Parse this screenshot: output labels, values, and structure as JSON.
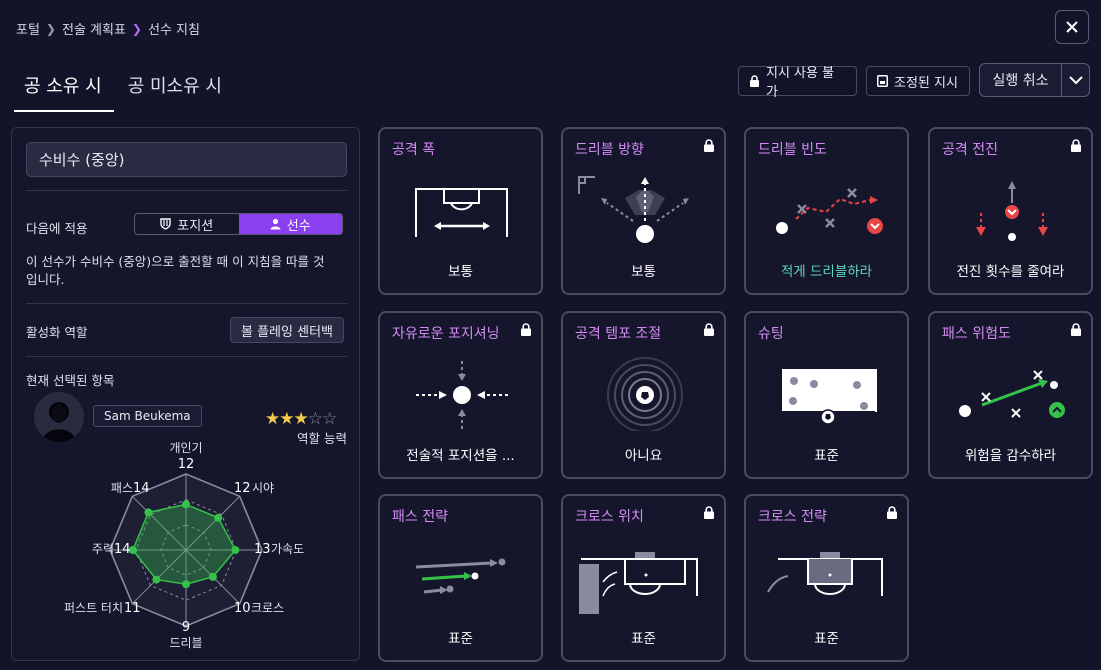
{
  "breadcrumb": [
    "포털",
    "전술 계획표",
    "선수 지침"
  ],
  "tabs": [
    "공 소유 시",
    "공 미소유 시"
  ],
  "top_buttons": {
    "unavailable": "지시 사용 불가",
    "adjusted": "조정된 지시",
    "undo": "실행 취소"
  },
  "left": {
    "role_select": "수비수 (중앙)",
    "apply_label": "다음에 적용",
    "toggle": [
      "포지션",
      "선수"
    ],
    "description": "이 선수가 수비수 (중앙)으로 출전할 때 이 지침을 따를 것입니다.",
    "active_role_label": "활성화 역할",
    "active_role": "볼 플레잉 센터백",
    "selected_label": "현재 선택된 항목",
    "player_name": "Sam Beukema",
    "role_ability": "역할 능력",
    "role_ability_stars": 3,
    "stats": [
      {
        "name": "개인기",
        "value": "12"
      },
      {
        "name": "시야",
        "value": "12"
      },
      {
        "name": "가속도",
        "value": "13"
      },
      {
        "name": "크로스",
        "value": "10"
      },
      {
        "name": "드리블",
        "value": "9"
      },
      {
        "name": "퍼스트 터치",
        "value": "11"
      },
      {
        "name": "주력",
        "value": "14"
      },
      {
        "name": "패스",
        "value": "14"
      }
    ]
  },
  "cards": [
    {
      "title": "공격 폭",
      "value": "보통",
      "locked": false
    },
    {
      "title": "드리블 방향",
      "value": "보통",
      "locked": true
    },
    {
      "title": "드리블 빈도",
      "value": "적게 드리블하라",
      "locked": false
    },
    {
      "title": "공격 전진",
      "value": "전진 횟수를 줄여라",
      "locked": true
    },
    {
      "title": "자유로운 포지셔닝",
      "value": "전술적 포지션을 ...",
      "locked": true
    },
    {
      "title": "공격 템포 조절",
      "value": "아니요",
      "locked": true
    },
    {
      "title": "슈팅",
      "value": "표준",
      "locked": false
    },
    {
      "title": "패스 위험도",
      "value": "위험을 감수하라",
      "locked": true
    },
    {
      "title": "패스 전략",
      "value": "표준",
      "locked": false
    },
    {
      "title": "크로스 위치",
      "value": "표준",
      "locked": true
    },
    {
      "title": "크로스 전략",
      "value": "표준",
      "locked": true
    }
  ],
  "colors": {
    "accent": "#8a3ff0",
    "title": "#d48bf4",
    "positive": "#5ed8b8",
    "radar": "#34c24a",
    "negative": "#e84545"
  }
}
